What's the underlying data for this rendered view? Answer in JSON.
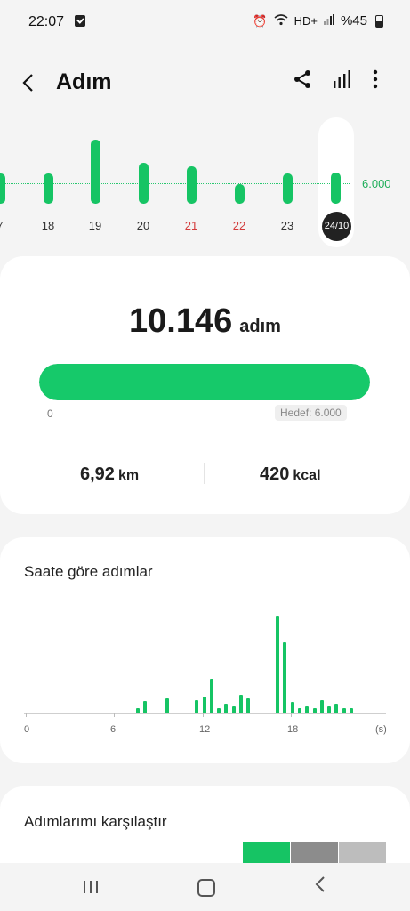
{
  "status_bar": {
    "time": "22:07",
    "battery": "%45",
    "icons": [
      "alarm-icon",
      "wifi-icon",
      "hd-plus-icon",
      "signal-icon",
      "battery-icon"
    ],
    "hd_label": "HD+"
  },
  "header": {
    "title": "Adım",
    "back_icon": "‹",
    "actions": [
      "share-icon",
      "chart-icon",
      "more-icon"
    ]
  },
  "week": {
    "goal_label": "6.000",
    "selected_label": "24/10",
    "days": [
      {
        "label": "7",
        "steps_fraction": 0.42,
        "red": false
      },
      {
        "label": "18",
        "steps_fraction": 0.42,
        "red": false
      },
      {
        "label": "19",
        "steps_fraction": 0.9,
        "red": false
      },
      {
        "label": "20",
        "steps_fraction": 0.57,
        "red": false
      },
      {
        "label": "21",
        "steps_fraction": 0.52,
        "red": true
      },
      {
        "label": "22",
        "steps_fraction": 0.27,
        "red": true
      },
      {
        "label": "23",
        "steps_fraction": 0.42,
        "red": false
      },
      {
        "label": "24/10",
        "steps_fraction": 0.44,
        "red": false
      }
    ]
  },
  "summary": {
    "steps": "10.146",
    "steps_unit": "adım",
    "progress_fraction": 1.0,
    "progress_min": "0",
    "goal_text": "Hedef: 6.000",
    "distance": "6,92",
    "distance_unit": "km",
    "calories": "420",
    "calories_unit": "kcal",
    "accent": "#16c96a"
  },
  "hourly": {
    "title": "Saate göre adımlar",
    "axis_labels": [
      "0",
      "6",
      "12",
      "18",
      "(s)"
    ],
    "max_hour": 24,
    "bars": [
      {
        "hour": 7.5,
        "value": 0.05
      },
      {
        "hour": 8.0,
        "value": 0.13
      },
      {
        "hour": 9.5,
        "value": 0.15
      },
      {
        "hour": 11.5,
        "value": 0.14
      },
      {
        "hour": 12.0,
        "value": 0.17
      },
      {
        "hour": 12.5,
        "value": 0.35
      },
      {
        "hour": 13.0,
        "value": 0.05
      },
      {
        "hour": 13.5,
        "value": 0.1
      },
      {
        "hour": 14.0,
        "value": 0.07
      },
      {
        "hour": 14.5,
        "value": 0.19
      },
      {
        "hour": 15.0,
        "value": 0.15
      },
      {
        "hour": 17.0,
        "value": 1.0
      },
      {
        "hour": 17.5,
        "value": 0.73
      },
      {
        "hour": 18.0,
        "value": 0.12
      },
      {
        "hour": 18.5,
        "value": 0.05
      },
      {
        "hour": 19.0,
        "value": 0.07
      },
      {
        "hour": 19.5,
        "value": 0.05
      },
      {
        "hour": 20.0,
        "value": 0.14
      },
      {
        "hour": 20.5,
        "value": 0.07
      },
      {
        "hour": 21.0,
        "value": 0.1
      },
      {
        "hour": 21.5,
        "value": 0.05
      },
      {
        "hour": 22.0,
        "value": 0.05
      }
    ]
  },
  "compare": {
    "title": "Adımlarımı karşılaştır",
    "segments": [
      "#16c464",
      "#8c8c8c",
      "#bdbdbd"
    ]
  },
  "nav": {
    "recent_icon": "|||",
    "back_icon": "‹"
  }
}
